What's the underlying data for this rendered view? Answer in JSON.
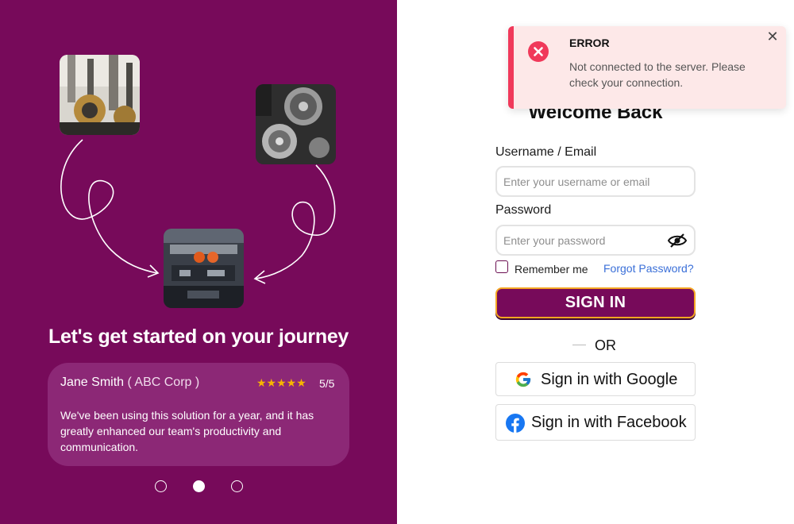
{
  "hero": {
    "title": "Let's get started on your journey",
    "images": [
      "machine-parts-photo",
      "engine-pulley-photo",
      "engine-bay-photo"
    ]
  },
  "testimonial": {
    "name": "Jane Smith",
    "company": "( ABC Corp )",
    "stars": "★★★★★",
    "score": "5/5",
    "rating": 5,
    "quote": "We've been using this solution for a year, and it has greatly enhanced our team's productivity and communication."
  },
  "carousel": {
    "count": 3,
    "active_index": 1
  },
  "login": {
    "title": "Welcome Back",
    "username_label": "Username / Email",
    "username_placeholder": "Enter your username or email",
    "username_value": "",
    "password_label": "Password",
    "password_placeholder": "Enter your password",
    "password_value": "",
    "remember_label": "Remember me",
    "remember_checked": false,
    "forgot_label": "Forgot Password?",
    "submit_label": "SIGN IN",
    "divider_label": "OR",
    "google_label": "Sign in with Google",
    "facebook_label": "Sign in with Facebook"
  },
  "toast": {
    "title": "ERROR",
    "message": "Not connected to the server. Please check your connection.",
    "close_glyph": "✕"
  },
  "colors": {
    "brand": "#770a5a",
    "card": "#8c2876",
    "accent_border": "#f5a623",
    "error": "#f0395a",
    "error_bg": "#fde8e8",
    "link": "#3a6fd8",
    "star": "#f7b500"
  },
  "icons": [
    "eye-slash-icon",
    "google-icon",
    "facebook-icon",
    "error-icon",
    "close-icon",
    "star-icon"
  ]
}
